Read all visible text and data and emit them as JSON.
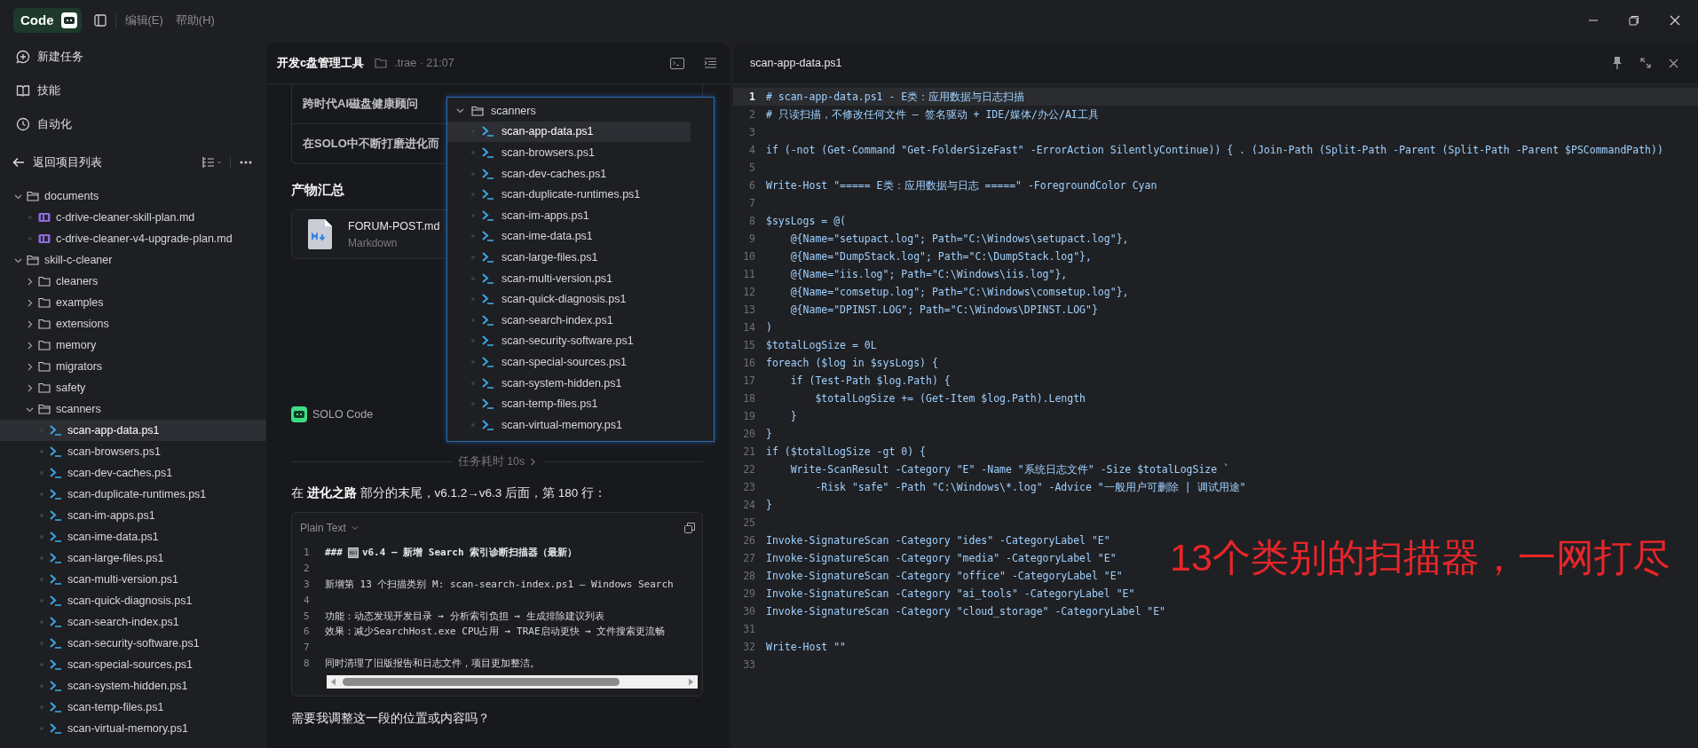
{
  "titlebar": {
    "badge": "Code",
    "menus": [
      "编辑(E)",
      "帮助(H)"
    ]
  },
  "nav": [
    {
      "label": "新建任务",
      "kind": "new-task"
    },
    {
      "label": "技能",
      "kind": "skills"
    },
    {
      "label": "自动化",
      "kind": "automation"
    }
  ],
  "project_header": {
    "back_label": "返回项目列表"
  },
  "file_tree": [
    {
      "name": "documents",
      "kind": "folder",
      "expanded": true,
      "selected": false,
      "children": [
        {
          "name": "c-drive-cleaner-skill-plan.md",
          "kind": "md",
          "selected": false
        },
        {
          "name": "c-drive-cleaner-v4-upgrade-plan.md",
          "kind": "md",
          "selected": false
        }
      ]
    },
    {
      "name": "skill-c-cleaner",
      "kind": "folder",
      "expanded": true,
      "selected": false,
      "children": [
        {
          "name": "cleaners",
          "kind": "folder",
          "expanded": false,
          "selected": false
        },
        {
          "name": "examples",
          "kind": "folder",
          "expanded": false,
          "selected": false
        },
        {
          "name": "extensions",
          "kind": "folder",
          "expanded": false,
          "selected": false
        },
        {
          "name": "memory",
          "kind": "folder",
          "expanded": false,
          "selected": false
        },
        {
          "name": "migrators",
          "kind": "folder",
          "expanded": false,
          "selected": false
        },
        {
          "name": "safety",
          "kind": "folder",
          "expanded": false,
          "selected": false
        },
        {
          "name": "scanners",
          "kind": "folder",
          "expanded": true,
          "selected": false,
          "children": [
            {
              "name": "scan-app-data.ps1",
              "kind": "ps1",
              "selected": true
            },
            {
              "name": "scan-browsers.ps1",
              "kind": "ps1",
              "selected": false
            },
            {
              "name": "scan-dev-caches.ps1",
              "kind": "ps1",
              "selected": false
            },
            {
              "name": "scan-duplicate-runtimes.ps1",
              "kind": "ps1",
              "selected": false
            },
            {
              "name": "scan-im-apps.ps1",
              "kind": "ps1",
              "selected": false
            },
            {
              "name": "scan-ime-data.ps1",
              "kind": "ps1",
              "selected": false
            },
            {
              "name": "scan-large-files.ps1",
              "kind": "ps1",
              "selected": false
            },
            {
              "name": "scan-multi-version.ps1",
              "kind": "ps1",
              "selected": false
            },
            {
              "name": "scan-quick-diagnosis.ps1",
              "kind": "ps1",
              "selected": false
            },
            {
              "name": "scan-search-index.ps1",
              "kind": "ps1",
              "selected": false
            },
            {
              "name": "scan-security-software.ps1",
              "kind": "ps1",
              "selected": false
            },
            {
              "name": "scan-special-sources.ps1",
              "kind": "ps1",
              "selected": false
            },
            {
              "name": "scan-system-hidden.ps1",
              "kind": "ps1",
              "selected": false
            },
            {
              "name": "scan-temp-files.ps1",
              "kind": "ps1",
              "selected": false
            },
            {
              "name": "scan-virtual-memory.ps1",
              "kind": "ps1",
              "selected": false
            }
          ]
        }
      ]
    }
  ],
  "chat": {
    "title": "开发c盘管理工具",
    "folder": ".trae · 21:07",
    "table_rows": [
      "跨时代AI磁盘健康顾问",
      "在SOLO中不断打磨进化而"
    ],
    "artifacts_heading": "产物汇总",
    "artifact": {
      "name": "FORUM-POST.md",
      "type": "Markdown"
    },
    "agent": "SOLO Code",
    "duration": "任务耗时 10s",
    "message": "在 **进化之路** 部分的末尾，v6.1.2→v6.3 后面，第 180 行：",
    "code_block": {
      "language": "Plain Text",
      "lines": [
        {
          "number": "1",
          "kind": "heading",
          "prefix": "###",
          "text": "v6.4 — 新增 Search 索引诊断扫描器（最新）"
        },
        {
          "number": "2",
          "kind": "plain"
        },
        {
          "number": "3",
          "kind": "plain",
          "text": "新增第 13 个扫描类别 M: scan-search-index.ps1 — Windows Search"
        },
        {
          "number": "4",
          "kind": "plain"
        },
        {
          "number": "5",
          "kind": "plain",
          "text": "功能：动态发现开发目录 → 分析索引负担 → 生成排除建议列表"
        },
        {
          "number": "6",
          "kind": "plain",
          "text": "效果：减少SearchHost.exe CPU占用 → TRAE启动更快 → 文件搜索更流畅"
        },
        {
          "number": "7",
          "kind": "plain"
        },
        {
          "number": "8",
          "kind": "plain",
          "text": "同时清理了旧版报告和日志文件，项目更加整洁。"
        }
      ]
    },
    "question": "需要我调整这一段的位置或内容吗？"
  },
  "tree_popup": {
    "folder": "scanners",
    "expanded": true,
    "items": [
      {
        "name": "scan-app-data.ps1",
        "selected": true
      },
      {
        "name": "scan-browsers.ps1",
        "selected": false
      },
      {
        "name": "scan-dev-caches.ps1",
        "selected": false
      },
      {
        "name": "scan-duplicate-runtimes.ps1",
        "selected": false
      },
      {
        "name": "scan-im-apps.ps1",
        "selected": false
      },
      {
        "name": "scan-ime-data.ps1",
        "selected": false
      },
      {
        "name": "scan-large-files.ps1",
        "selected": false
      },
      {
        "name": "scan-multi-version.ps1",
        "selected": false
      },
      {
        "name": "scan-quick-diagnosis.ps1",
        "selected": false
      },
      {
        "name": "scan-search-index.ps1",
        "selected": false
      },
      {
        "name": "scan-security-software.ps1",
        "selected": false
      },
      {
        "name": "scan-special-sources.ps1",
        "selected": false
      },
      {
        "name": "scan-system-hidden.ps1",
        "selected": false
      },
      {
        "name": "scan-temp-files.ps1",
        "selected": false
      },
      {
        "name": "scan-virtual-memory.ps1",
        "selected": false
      }
    ]
  },
  "editor": {
    "tab": "scan-app-data.ps1",
    "lines": [
      {
        "n": "1",
        "current": true,
        "code": "# scan-app-data.ps1 - E类：应用数据与日志扫描"
      },
      {
        "n": "2",
        "current": false,
        "code": "# 只读扫描，不修改任何文件 — 签名驱动 + IDE/媒体/办公/AI工具"
      },
      {
        "n": "3",
        "current": false
      },
      {
        "n": "4",
        "current": false,
        "code": "if (-not (Get-Command \"Get-FolderSizeFast\" -ErrorAction SilentlyContinue)) { . (Join-Path (Split-Path -Parent (Split-Path -Parent $PSCommandPath))"
      },
      {
        "n": "5",
        "current": false
      },
      {
        "n": "6",
        "current": false,
        "code": "Write-Host \"===== E类：应用数据与日志 =====\" -ForegroundColor Cyan"
      },
      {
        "n": "7",
        "current": false
      },
      {
        "n": "8",
        "current": false,
        "code": "$sysLogs = @("
      },
      {
        "n": "9",
        "current": false,
        "code": "    @{Name=\"setupact.log\"; Path=\"C:\\Windows\\setupact.log\"},"
      },
      {
        "n": "10",
        "current": false,
        "code": "    @{Name=\"DumpStack.log\"; Path=\"C:\\DumpStack.log\"},"
      },
      {
        "n": "11",
        "current": false,
        "code": "    @{Name=\"iis.log\"; Path=\"C:\\Windows\\iis.log\"},"
      },
      {
        "n": "12",
        "current": false,
        "code": "    @{Name=\"comsetup.log\"; Path=\"C:\\Windows\\comsetup.log\"},"
      },
      {
        "n": "13",
        "current": false,
        "code": "    @{Name=\"DPINST.LOG\"; Path=\"C:\\Windows\\DPINST.LOG\"}"
      },
      {
        "n": "14",
        "current": false,
        "code": ")"
      },
      {
        "n": "15",
        "current": false,
        "code": "$totalLogSize = 0L"
      },
      {
        "n": "16",
        "current": false,
        "code": "foreach ($log in $sysLogs) {"
      },
      {
        "n": "17",
        "current": false,
        "code": "    if (Test-Path $log.Path) {"
      },
      {
        "n": "18",
        "current": false,
        "code": "        $totalLogSize += (Get-Item $log.Path).Length"
      },
      {
        "n": "19",
        "current": false,
        "code": "    }"
      },
      {
        "n": "20",
        "current": false,
        "code": "}"
      },
      {
        "n": "21",
        "current": false,
        "code": "if ($totalLogSize -gt 0) {"
      },
      {
        "n": "22",
        "current": false,
        "code": "    Write-ScanResult -Category \"E\" -Name \"系统日志文件\" -Size $totalLogSize `"
      },
      {
        "n": "23",
        "current": false,
        "code": "        -Risk \"safe\" -Path \"C:\\Windows\\*.log\" -Advice \"一般用户可删除 | 调试用途\""
      },
      {
        "n": "24",
        "current": false,
        "code": "}"
      },
      {
        "n": "25",
        "current": false
      },
      {
        "n": "26",
        "current": false,
        "code": "Invoke-SignatureScan -Category \"ides\" -CategoryLabel \"E\""
      },
      {
        "n": "27",
        "current": false,
        "code": "Invoke-SignatureScan -Category \"media\" -CategoryLabel \"E\""
      },
      {
        "n": "28",
        "current": false,
        "code": "Invoke-SignatureScan -Category \"office\" -CategoryLabel \"E\""
      },
      {
        "n": "29",
        "current": false,
        "code": "Invoke-SignatureScan -Category \"ai_tools\" -CategoryLabel \"E\""
      },
      {
        "n": "30",
        "current": false,
        "code": "Invoke-SignatureScan -Category \"cloud_storage\" -CategoryLabel \"E\""
      },
      {
        "n": "31",
        "current": false
      },
      {
        "n": "32",
        "current": false,
        "code": "Write-Host \"\""
      },
      {
        "n": "33",
        "current": false
      }
    ]
  },
  "annotation": {
    "text": "13个类别的扫描器，一网打尽"
  }
}
